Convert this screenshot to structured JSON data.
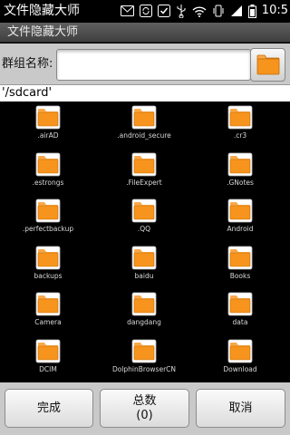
{
  "status_bar": {
    "app_title": "文件隐藏大师",
    "time": "10:5"
  },
  "title_bar": {
    "title": "文件隐藏大师"
  },
  "group": {
    "label": "群组名称:",
    "input_value": "",
    "input_placeholder": ""
  },
  "path": {
    "current": "'/sdcard'"
  },
  "folders": [
    ".airAD",
    ".android_secure",
    ".cr3",
    ".estrongs",
    ".FileExpert",
    ".GNotes",
    ".perfectbackup",
    ".QQ",
    "Android",
    "backups",
    "baidu",
    "Books",
    "Camera",
    "dangdang",
    "data",
    "DCIM",
    "DolphinBrowserCN",
    "Download",
    "",
    "",
    ""
  ],
  "buttons": {
    "done": "完成",
    "total_label": "总数",
    "total_count": "(0)",
    "cancel": "取消"
  },
  "colors": {
    "folder_orange": "#f7941d",
    "folder_tab": "#f9a94a",
    "folder_paper": "#ffffff"
  }
}
